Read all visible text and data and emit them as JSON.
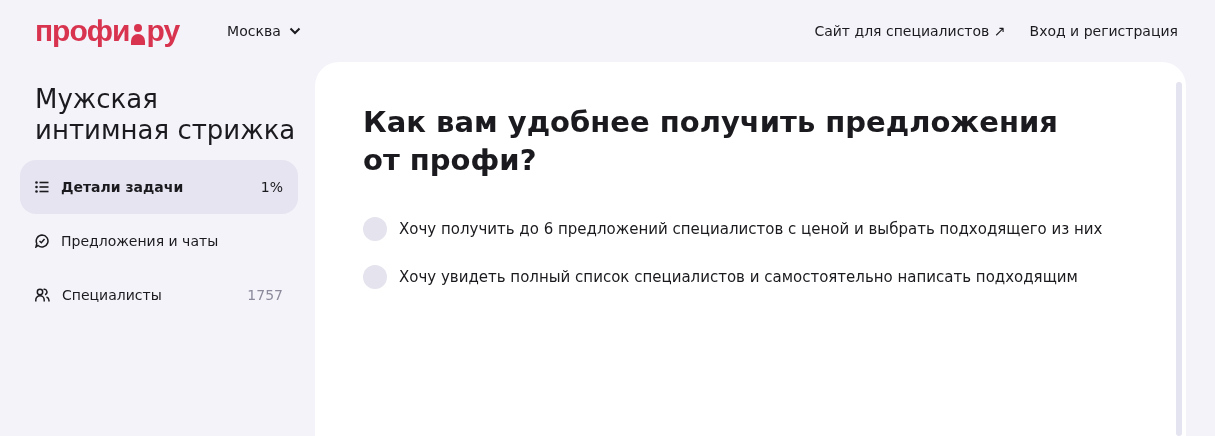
{
  "header": {
    "logo": {
      "left": "профи",
      "right": "ру"
    },
    "city": "Москва",
    "links": [
      {
        "label": "Сайт для специалистов ↗"
      },
      {
        "label": "Вход и регистрация"
      }
    ]
  },
  "sidebar": {
    "title": "Мужская интимная стрижка",
    "items": [
      {
        "kind": "list",
        "label": "Детали задачи",
        "count": "1%",
        "selected": true
      },
      {
        "kind": "chat",
        "label": "Предложения и чаты",
        "selected": false
      },
      {
        "kind": "people",
        "label": "Специалисты",
        "count": "1757",
        "selected": false
      }
    ]
  },
  "question": {
    "title": "Как вам удобнее получить предложения от профи?",
    "options": [
      {
        "label": "Хочу получить до 6 предложений специалистов с ценой и выбрать подходящего из них",
        "selected": false
      },
      {
        "label": "Хочу увидеть полный список специалистов и самостоятельно написать подходящим",
        "selected": false
      }
    ]
  }
}
